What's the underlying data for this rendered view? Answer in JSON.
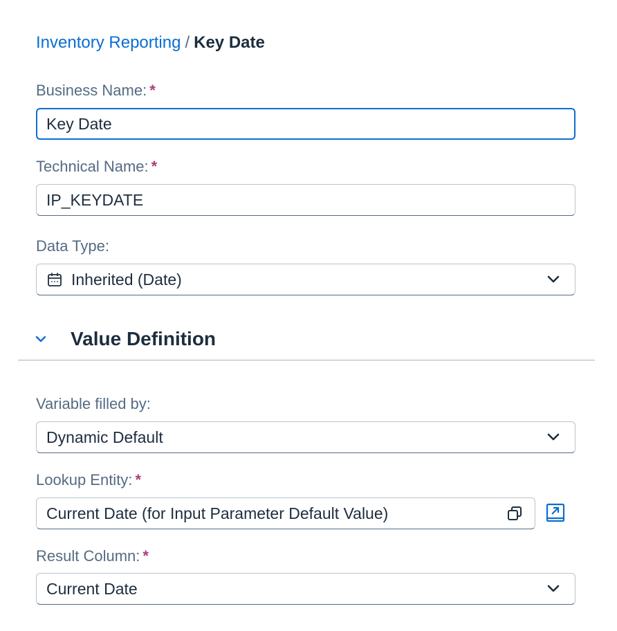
{
  "breadcrumb": {
    "parent": "Inventory Reporting",
    "separator": "/",
    "current": "Key Date"
  },
  "business_name": {
    "label": "Business Name:",
    "required_mark": "*",
    "value": "Key Date"
  },
  "technical_name": {
    "label": "Technical Name:",
    "required_mark": "*",
    "value": "IP_KEYDATE"
  },
  "data_type": {
    "label": "Data Type:",
    "value": "Inherited (Date)",
    "icon": "calendar-icon"
  },
  "value_definition": {
    "title": "Value Definition",
    "expanded": true
  },
  "variable_filled_by": {
    "label": "Variable filled by:",
    "value": "Dynamic Default"
  },
  "lookup_entity": {
    "label": "Lookup Entity:",
    "required_mark": "*",
    "value": "Current Date (for Input Parameter Default Value)"
  },
  "result_column": {
    "label": "Result Column:",
    "required_mark": "*",
    "value": "Current Date"
  },
  "colors": {
    "link": "#0a6ed1",
    "required": "#a93e7d",
    "label": "#556b82",
    "text": "#1d2d3e",
    "focus_border": "#0a6ed1"
  }
}
